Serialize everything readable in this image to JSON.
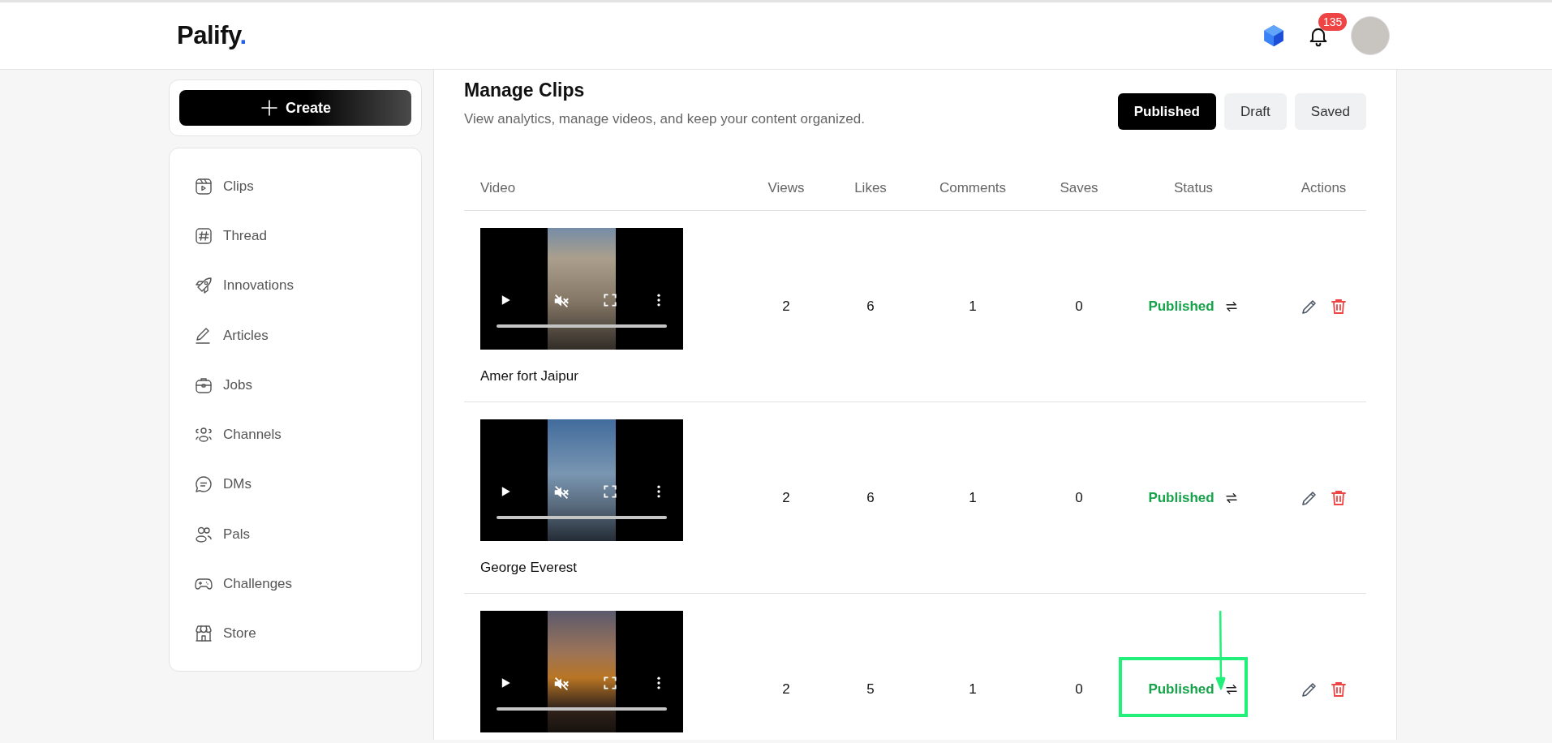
{
  "header": {
    "logo": "Palify",
    "logo_mark": ".",
    "notification_count": "135"
  },
  "sidebar": {
    "create_label": "Create",
    "items": [
      {
        "label": "Clips"
      },
      {
        "label": "Thread"
      },
      {
        "label": "Innovations"
      },
      {
        "label": "Articles"
      },
      {
        "label": "Jobs"
      },
      {
        "label": "Channels"
      },
      {
        "label": "DMs"
      },
      {
        "label": "Pals"
      },
      {
        "label": "Challenges"
      },
      {
        "label": "Store"
      }
    ]
  },
  "page": {
    "title": "Manage Clips",
    "subtitle": "View analytics, manage videos, and keep your content organized.",
    "tabs": [
      {
        "label": "Published",
        "selected": true
      },
      {
        "label": "Draft",
        "selected": false
      },
      {
        "label": "Saved",
        "selected": false
      }
    ]
  },
  "table": {
    "columns": [
      "Video",
      "Views",
      "Likes",
      "Comments",
      "Saves",
      "Status",
      "Actions"
    ],
    "rows": [
      {
        "title": "Amer fort Jaipur",
        "level": 0,
        "views": "2",
        "likes": "6",
        "comments": "1",
        "saves": "0",
        "status": "Published",
        "highlighted": false
      },
      {
        "title": "George Everest",
        "level": 0,
        "views": "2",
        "likes": "6",
        "comments": "1",
        "saves": "0",
        "status": "Published",
        "highlighted": false
      },
      {
        "level": 0,
        "views": "2",
        "likes": "5",
        "comments": "1",
        "saves": "0",
        "status": "Published",
        "highlighted": true
      }
    ]
  }
}
